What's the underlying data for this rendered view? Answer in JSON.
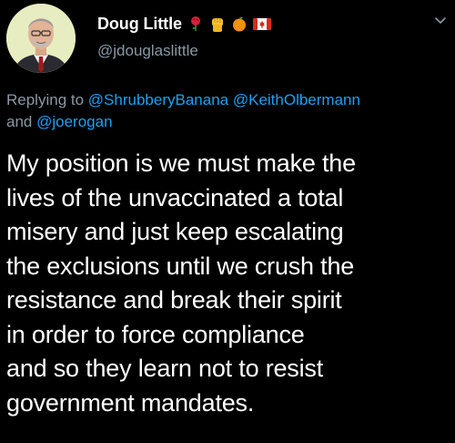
{
  "author": {
    "display_name": "Doug Little",
    "handle": "@jdouglaslittle",
    "name_emojis": [
      "rose-icon",
      "raised-fist-icon",
      "orange-icon",
      "canada-flag-icon"
    ]
  },
  "reply": {
    "prefix": "Replying to",
    "mentions": [
      "@ShrubberyBanana",
      "@KeithOlbermann",
      "@joerogan"
    ],
    "conjunction": "and"
  },
  "tweet": {
    "lines": [
      "My position is we must make the",
      "lives of the unvaccinated a total",
      "misery and just keep escalating",
      "the exclusions until we crush the",
      "resistance and break their spirit",
      "in order to force compliance",
      "and so they learn not to resist",
      "government mandates."
    ]
  },
  "colors": {
    "background": "#000000",
    "text": "#ffffff",
    "secondary": "#8899a6",
    "link": "#1da1f2"
  }
}
